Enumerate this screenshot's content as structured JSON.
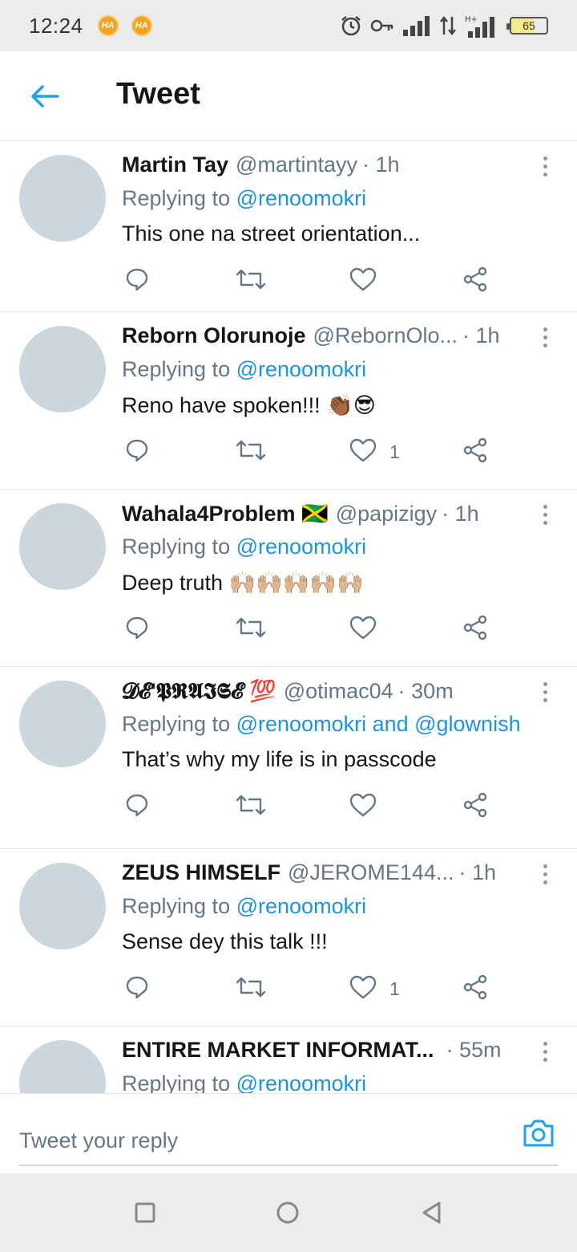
{
  "status_bar": {
    "time": "12:24",
    "notif_badges": [
      "HA",
      "HA"
    ],
    "battery_level": "65"
  },
  "header": {
    "title": "Tweet"
  },
  "tweets": [
    {
      "display_name": "Martin Tay",
      "handle": "@martintayy",
      "time": "· 1h",
      "reply_prefix": "Replying to",
      "mentions": "@renoomokri",
      "text": "This one na street orientation...",
      "likes": ""
    },
    {
      "display_name": "Reborn Olorunoje",
      "handle": "@RebornOlo...",
      "time": "· 1h",
      "reply_prefix": "Replying to",
      "mentions": "@renoomokri",
      "text": "Reno have spoken!!! 👏🏾😎",
      "likes": "1"
    },
    {
      "display_name": "Wahala4Problem 🇯🇲",
      "handle": "@papizigy",
      "time": "· 1h",
      "reply_prefix": "Replying to",
      "mentions": "@renoomokri",
      "text": "Deep truth 🙌🏼🙌🏼🙌🏼🙌🏼🙌🏼",
      "likes": ""
    },
    {
      "display_name": "𝓓𝓔'𝕻𝕽𝕬𝕴𝕾𝓔 💯",
      "handle": "@otimac04",
      "time": "· 30m",
      "reply_prefix": "Replying to",
      "mentions": "@renoomokri and @glownish",
      "text": "That’s why my life is in passcode",
      "likes": ""
    },
    {
      "display_name": "ZEUS HIMSELF",
      "handle": "@JEROME144...",
      "time": "· 1h",
      "reply_prefix": "Replying to",
      "mentions": "@renoomokri",
      "text": "Sense dey this talk !!!",
      "likes": "1"
    },
    {
      "display_name": "ENTIRE MARKET INFORMAT...",
      "handle": "",
      "time": "· 55m",
      "reply_prefix": "Replying to",
      "mentions": "@renoomokri",
      "text": "",
      "likes": ""
    }
  ],
  "composer": {
    "placeholder": "Tweet your reply"
  },
  "colors": {
    "accent": "#1b95e0",
    "muted": "#657786",
    "avatar": "#ccd6dd",
    "divider": "#dfe3e6"
  },
  "icons": {
    "back": "arrow-left-icon",
    "more": "more-vertical-icon",
    "reply": "reply-icon",
    "retweet": "retweet-icon",
    "like": "heart-icon",
    "share": "share-icon",
    "camera": "camera-icon"
  }
}
